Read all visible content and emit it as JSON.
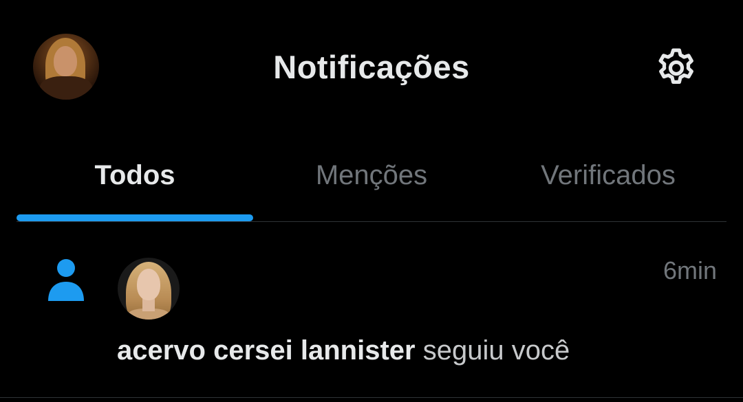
{
  "header": {
    "title": "Notificações",
    "profile_avatar_icon": "profile-avatar",
    "settings_icon": "gear-icon"
  },
  "tabs": [
    {
      "label": "Todos",
      "active": true
    },
    {
      "label": "Menções",
      "active": false
    },
    {
      "label": "Verificados",
      "active": false
    }
  ],
  "notifications": [
    {
      "type": "follow",
      "icon": "person-icon",
      "user": "acervo cersei lannister",
      "action": "seguiu você",
      "time": "6min"
    }
  ],
  "colors": {
    "background": "#000000",
    "accent": "#1d9bf0",
    "primary_text": "#e7e9ea",
    "secondary_text": "#71767b",
    "divider": "#2f3336"
  }
}
